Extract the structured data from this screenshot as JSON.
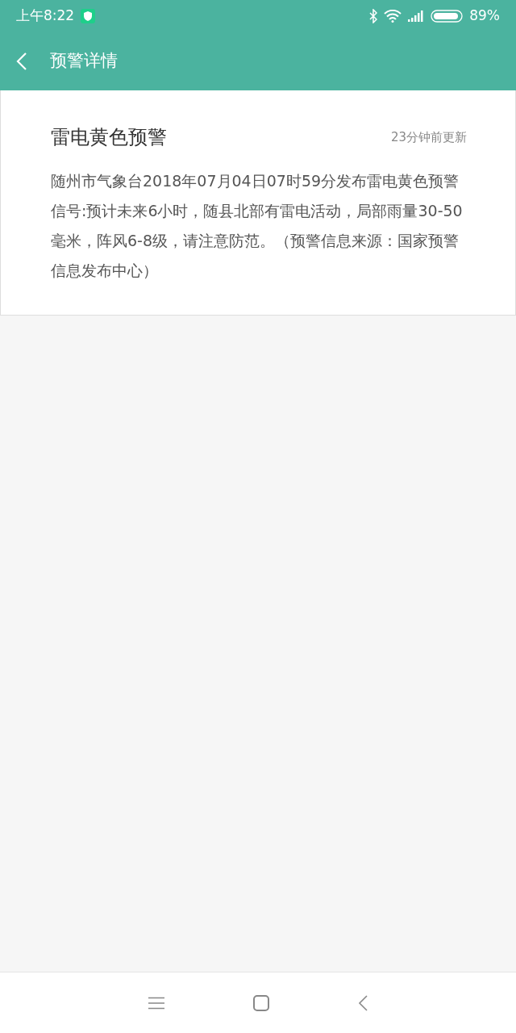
{
  "status_bar": {
    "time": "上午8:22",
    "battery": "89%"
  },
  "app_bar": {
    "title": "预警详情"
  },
  "alert": {
    "title": "雷电黄色预警",
    "updated": "23分钟前更新",
    "body": "随州市气象台2018年07月04日07时59分发布雷电黄色预警信号:预计未来6小时，随县北部有雷电活动，局部雨量30-50毫米，阵风6-8级，请注意防范。（预警信息来源：国家预警信息发布中心）"
  }
}
